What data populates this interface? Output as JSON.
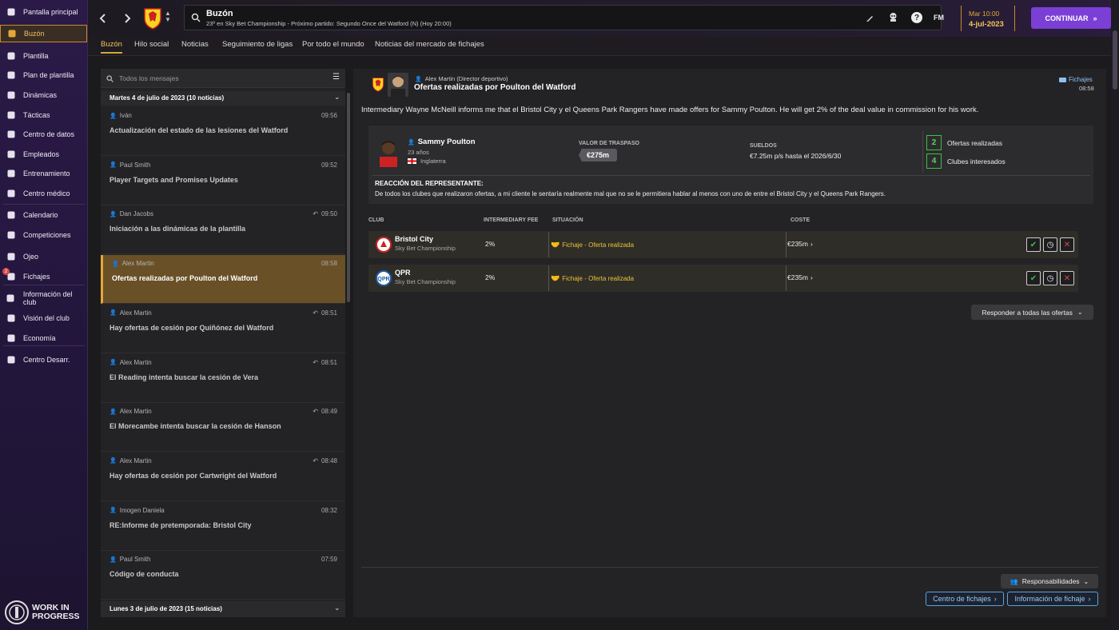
{
  "sidebar": {
    "items": [
      {
        "label": "Pantalla principal",
        "icon": "home-icon"
      },
      {
        "label": "Buzón",
        "icon": "inbox-icon"
      },
      {
        "label": "Plantilla",
        "icon": "shirt-icon"
      },
      {
        "label": "Plan de plantilla",
        "icon": "clipboard-icon"
      },
      {
        "label": "Dinámicas",
        "icon": "megaphone-icon"
      },
      {
        "label": "Tácticas",
        "icon": "tactics-icon"
      },
      {
        "label": "Centro de datos",
        "icon": "data-icon"
      },
      {
        "label": "Empleados",
        "icon": "staff-icon"
      },
      {
        "label": "Entrenamiento",
        "icon": "training-icon"
      },
      {
        "label": "Centro médico",
        "icon": "medical-icon"
      },
      {
        "label": "Calendario",
        "icon": "calendar-icon"
      },
      {
        "label": "Competiciones",
        "icon": "trophy-icon"
      },
      {
        "label": "Ojeo",
        "icon": "scouting-icon"
      },
      {
        "label": "Fichajes",
        "icon": "transfers-icon",
        "badge": "2"
      },
      {
        "label": "Información del club",
        "icon": "club-icon"
      },
      {
        "label": "Visión del club",
        "icon": "vision-icon"
      },
      {
        "label": "Economía",
        "icon": "finance-icon"
      },
      {
        "label": "Centro Desarr.",
        "icon": "development-icon"
      }
    ],
    "footer": {
      "line1": "WORK IN",
      "line2": "PROGRESS"
    }
  },
  "topbar": {
    "title": "Buzón",
    "subtitle": "23º en Sky Bet Championship - Próximo partido: Segundo Once del Watford (N) (Hoy 20:00)",
    "fm_label": "FM",
    "time": "Mar 10:00",
    "date": "4-jul-2023",
    "continue_label": "CONTINUAR"
  },
  "tabs": [
    "Buzón",
    "Hilo social",
    "Noticias",
    "Seguimiento de ligas",
    "Por todo el mundo",
    "Noticias del mercado de fichajes"
  ],
  "inbox": {
    "search_placeholder": "Todos los mensajes",
    "group1": "Martes 4 de julio de 2023 (10 noticias)",
    "group2": "Lunes 3 de julio de 2023 (15 noticias)",
    "messages": [
      {
        "from": "Iván",
        "time": "09:56",
        "subject": "Actualización del estado de las lesiones del Watford",
        "reply": false
      },
      {
        "from": "Paul Smith",
        "time": "09:52",
        "subject": "Player Targets and Promises Updates",
        "reply": false
      },
      {
        "from": "Dan Jacobs",
        "time": "09:50",
        "subject": "Iniciación a las dinámicas de la plantilla",
        "reply": true
      },
      {
        "from": "Alex Martin",
        "time": "08:58",
        "subject": "Ofertas realizadas por Poulton del Watford",
        "reply": false
      },
      {
        "from": "Alex Martin",
        "time": "08:51",
        "subject": "Hay ofertas de cesión por Quiñónez del Watford",
        "reply": true
      },
      {
        "from": "Alex Martin",
        "time": "08:51",
        "subject": "El Reading intenta buscar la cesión de Vera",
        "reply": true
      },
      {
        "from": "Alex Martin",
        "time": "08:49",
        "subject": "El Morecambe intenta buscar la cesión de Hanson",
        "reply": true
      },
      {
        "from": "Alex Martin",
        "time": "08:48",
        "subject": "Hay ofertas de cesión por Cartwright del Watford",
        "reply": true
      },
      {
        "from": "Imogen Daniela",
        "time": "08:32",
        "subject": "RE:Informe de pretemporada: Bristol City",
        "reply": false
      },
      {
        "from": "Paul Smith",
        "time": "07:59",
        "subject": "Código de conducta",
        "reply": false
      }
    ]
  },
  "detail": {
    "sender": "Alex Martin (Director deportivo)",
    "title": "Ofertas realizadas por Poulton del Watford",
    "tag": "Fichajes",
    "time": "08:58",
    "body": "Intermediary Wayne McNeill informs me that el Bristol City y el Queens Park Rangers have made offers for Sammy Poulton. He will get 2% of the deal value in commission for his work.",
    "player": {
      "name": "Sammy Poulton",
      "age": "23 años",
      "nation": "Inglaterra"
    },
    "value_label": "VALOR DE TRASPASO",
    "value": "€275m",
    "wages_label": "SUELDOS",
    "wages": "€7.25m p/s hasta el 2026/6/30",
    "offers_count": "2",
    "offers_label": "Ofertas realizadas",
    "clubs_count": "4",
    "clubs_label": "Clubes interesados",
    "reaction_title": "REACCIÓN DEL REPRESENTANTE:",
    "reaction_text": "De todos los clubes que realizaron ofertas, a mi cliente le sentaría realmente mal que no se le permitiera hablar al menos con uno de entre el Bristol City y el Queens Park Rangers.",
    "headers": {
      "club": "CLUB",
      "fee": "INTERMEDIARY FEE",
      "status": "SITUACIÓN",
      "cost": "COSTE"
    },
    "offers": [
      {
        "club": "Bristol City",
        "league": "Sky Bet Championship",
        "fee": "2%",
        "status": "Fichaje - Oferta realizada",
        "cost": "€235m"
      },
      {
        "club": "QPR",
        "league": "Sky Bet Championship",
        "fee": "2%",
        "status": "Fichaje - Oferta realizada",
        "cost": "€235m"
      }
    ],
    "respond_all": "Responder a todas las ofertas",
    "responsibilities": "Responsabilidades",
    "transfer_centre": "Centro de fichajes",
    "transfer_info": "Información de fichaje"
  },
  "colors": {
    "accent": "#7b3fd6",
    "gold": "#f3c658",
    "green": "#3fbe3f",
    "red": "#d94848"
  }
}
